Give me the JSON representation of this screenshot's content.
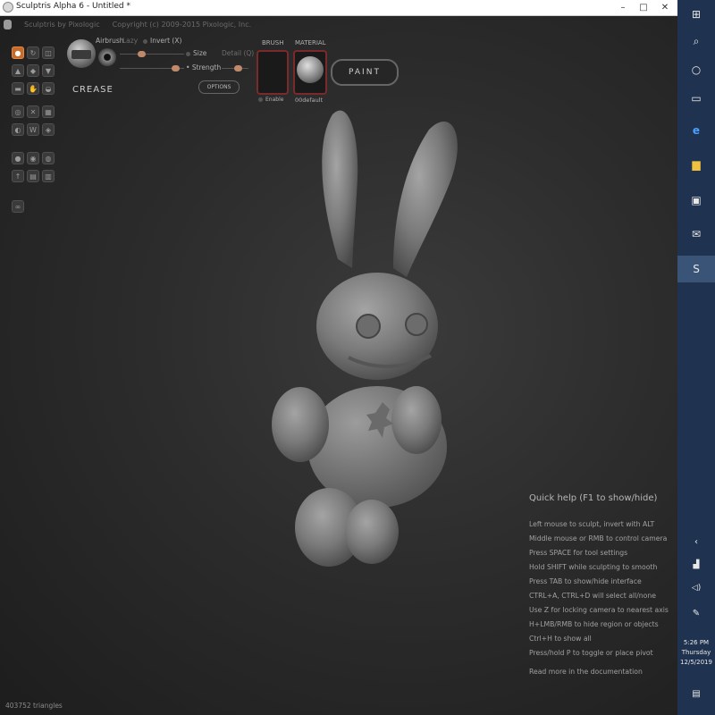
{
  "window": {
    "title": "Sculptris Alpha 6 - Untitled *",
    "minimize": "–",
    "maximize": "□",
    "close": "✕"
  },
  "menubar": {
    "items": [
      "Sculptris by Pixologic",
      "Copyright (c) 2009-2015 Pixologic, Inc."
    ]
  },
  "tools": {
    "rows": [
      [
        "crease-tool",
        "rotate-tool",
        "scale-tool"
      ],
      [
        "draw-tool",
        "inflate-tool",
        "pinch-tool"
      ],
      [
        "flatten-tool",
        "grab-tool",
        "smooth-tool"
      ],
      [
        "reduce-tool",
        "symmetry-tool",
        "wireframe-tool"
      ],
      [
        "paint-tool",
        "mirror-tool",
        "subdivide-tool"
      ],
      [
        "sphere-tool",
        "plane-tool",
        "import-tool"
      ],
      [
        "export-tool",
        "save-tool",
        "options-tool"
      ],
      [
        "camera-tool"
      ]
    ],
    "active": "crease-tool",
    "accent_color": "#c86a2a"
  },
  "brush": {
    "name": "CREASE",
    "airbrush": "Airbrush",
    "lazy": "Lazy",
    "invert": "Invert (X)",
    "size": "Size",
    "strength": "Strength",
    "detail": "Detail (Q)",
    "options": "OPTIONS"
  },
  "panels": {
    "brush_label": "BRUSH",
    "enable": "Enable",
    "material_label": "MATERIAL",
    "material_name": "00default",
    "paint_button": "PAINT"
  },
  "quick_help": {
    "title": "Quick help (F1 to show/hide)",
    "lines": [
      "Left mouse to sculpt, invert with ALT",
      "Middle mouse or RMB to control camera",
      "Press SPACE for tool settings",
      "Hold SHIFT while sculpting to smooth",
      "Press TAB to show/hide interface",
      "CTRL+A, CTRL+D will select all/none",
      "Use Z for locking camera to nearest axis",
      "H+LMB/RMB to hide region or objects",
      "Ctrl+H to show all",
      "Press/hold P to toggle or place pivot"
    ],
    "more": "Read more in the documentation"
  },
  "status": {
    "triangles": "403752 triangles"
  },
  "taskbar": {
    "time": "5:26 PM",
    "day": "Thursday",
    "date": "12/5/2019",
    "icons": [
      "windows-icon",
      "search-icon",
      "cortana-icon",
      "task-view-icon",
      "edge-icon",
      "file-explorer-icon",
      "store-icon",
      "mail-icon",
      "sculptris-icon"
    ]
  }
}
